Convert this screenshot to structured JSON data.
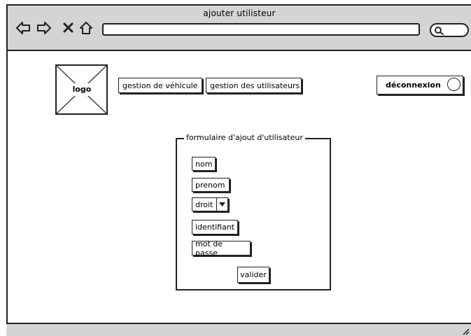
{
  "window": {
    "title": "ajouter utilisteur",
    "url": ""
  },
  "browser_controls": {
    "back_icon": "arrow-left-icon",
    "forward_icon": "arrow-right-icon",
    "stop_icon": "close-icon",
    "home_icon": "home-icon",
    "search_icon": "search-icon"
  },
  "header": {
    "logo_label": "logo",
    "nav": {
      "vehicles_label": "gestion de véhicule",
      "users_label": "gestion des utilisateurs"
    },
    "logout_label": "déconnexion"
  },
  "form": {
    "legend": "formulaire d'ajout d'utilisateur",
    "fields": {
      "nom": "nom",
      "prenom": "prenom",
      "droit": "droit",
      "identifiant": "identifiant",
      "mot_de_passe": "mot de passe"
    },
    "submit_label": "valider"
  },
  "colors": {
    "chrome": "#d4d4d4",
    "stroke": "#222222",
    "background": "#ffffff"
  }
}
